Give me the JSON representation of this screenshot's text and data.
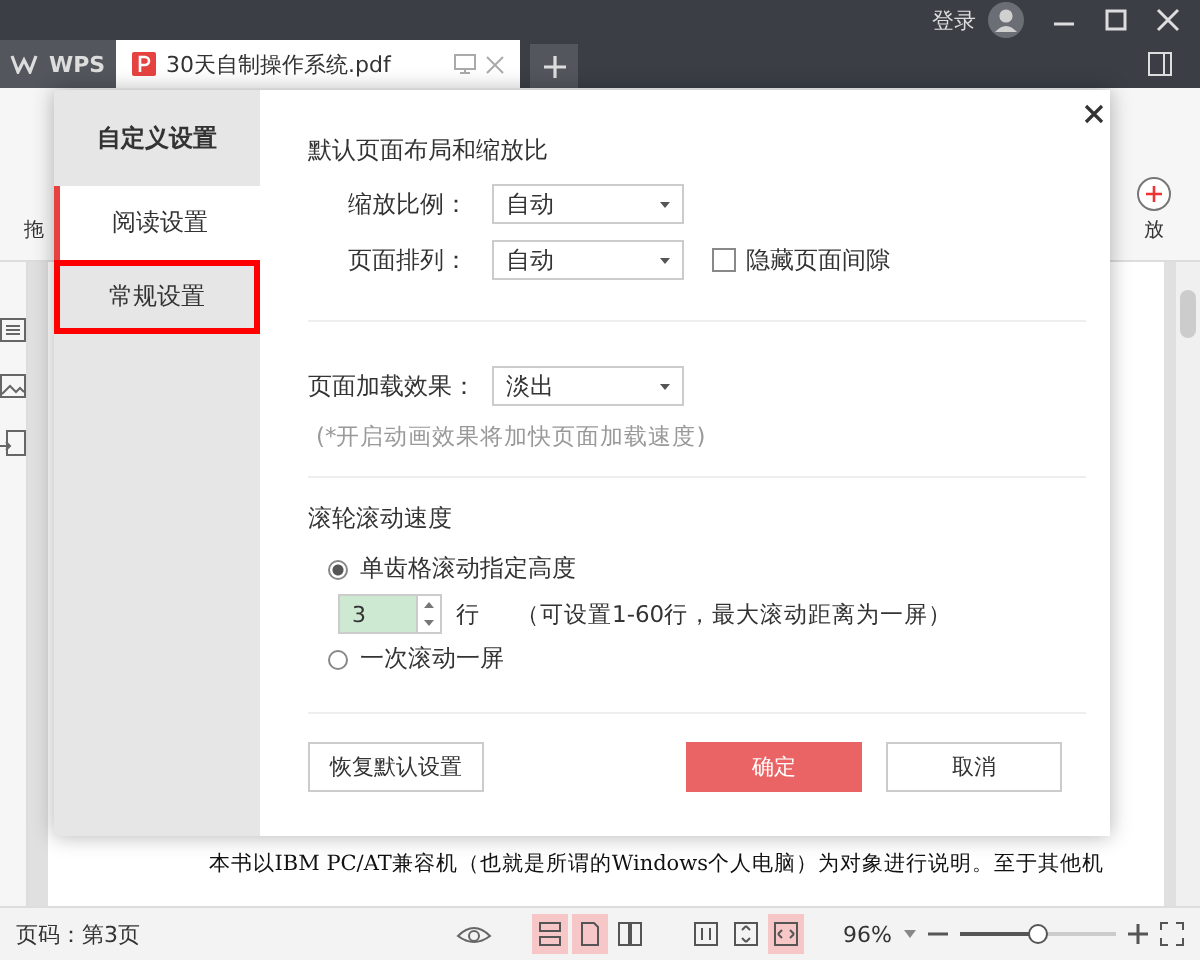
{
  "title_bar": {
    "login": "登录"
  },
  "tabs": [
    {
      "label": "WPS",
      "kind": "app",
      "selected": false
    },
    {
      "label": "30天自制操作系统.pdf",
      "kind": "doc",
      "selected": true
    }
  ],
  "toolbar": {
    "left_label": "拖",
    "right_label": "放"
  },
  "document": {
    "text": "本书以IBM PC/AT兼容机（也就是所谓的Windows个人电脑）为对象进行说明。至于其他机"
  },
  "dialog": {
    "title": "自定义设置",
    "nav": [
      {
        "label": "阅读设置",
        "selected": true,
        "highlighted": false
      },
      {
        "label": "常规设置",
        "selected": false,
        "highlighted": true
      }
    ],
    "layout_section": {
      "heading": "默认页面布局和缩放比",
      "zoom_label": "缩放比例：",
      "zoom_value": "自动",
      "arrange_label": "页面排列：",
      "arrange_value": "自动",
      "hide_gap": {
        "label": "隐藏页面间隙",
        "checked": false
      }
    },
    "load_section": {
      "label": "页面加载效果：",
      "value": "淡出",
      "hint": "(*开启动画效果将加快页面加载速度)"
    },
    "scroll_section": {
      "heading": "滚轮滚动速度",
      "options": [
        {
          "label": "单齿格滚动指定高度",
          "selected": true
        },
        {
          "label": "一次滚动一屏",
          "selected": false
        }
      ],
      "lines_value": "3",
      "lines_unit": "行",
      "lines_hint": "（可设置1-60行，最大滚动距离为一屏）"
    },
    "buttons": {
      "reset": "恢复默认设置",
      "ok": "确定",
      "cancel": "取消"
    }
  },
  "status_bar": {
    "page": "页码：第3页",
    "view_modes": [
      {
        "selected": true
      },
      {
        "selected": true
      },
      {
        "selected": false
      }
    ],
    "fit_modes": [
      {
        "selected": false
      },
      {
        "selected": false
      },
      {
        "selected": true
      }
    ],
    "zoom": "96%",
    "zoom_slider": {
      "level": 0.5
    }
  }
}
